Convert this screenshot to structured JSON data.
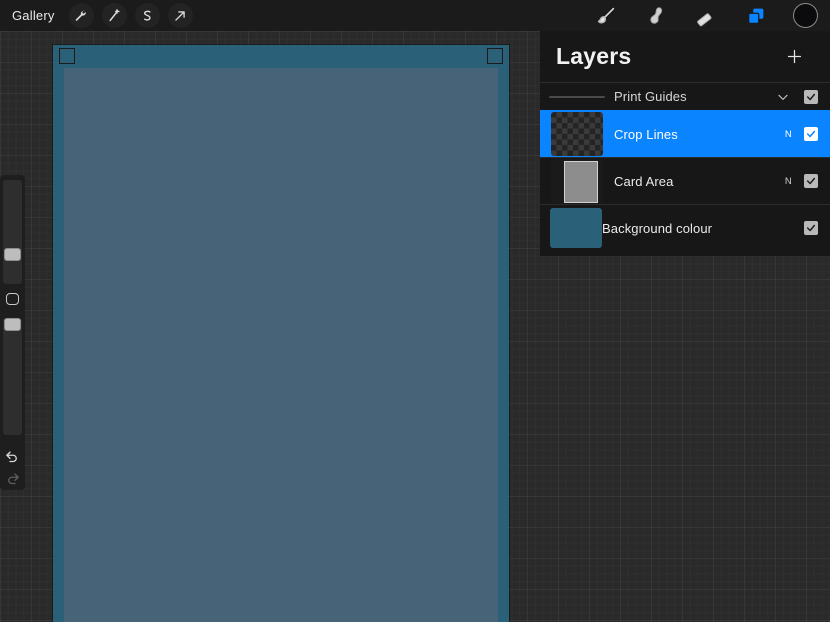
{
  "app": {
    "accent_color": "#0a84ff",
    "background_color": "#2a2a2a",
    "toolbar_color": "#1b1b1b"
  },
  "toolbar": {
    "gallery_label": "Gallery",
    "left_tools": [
      {
        "name": "actions-wrench-icon",
        "label": "Actions"
      },
      {
        "name": "adjustments-wand-icon",
        "label": "Adjustments"
      },
      {
        "name": "selection-icon",
        "label": "Selection"
      },
      {
        "name": "transform-arrow-icon",
        "label": "Transform"
      }
    ],
    "right_tools": [
      {
        "name": "paint-brush-icon",
        "label": "Paint"
      },
      {
        "name": "smudge-icon",
        "label": "Smudge"
      },
      {
        "name": "eraser-icon",
        "label": "Erase"
      },
      {
        "name": "layers-icon",
        "label": "Layers",
        "active": true
      },
      {
        "name": "color-swatch",
        "label": "Colour",
        "color": "#0b0b0d"
      }
    ]
  },
  "sidebar": {
    "brush_size": {
      "name": "brush-size-slider",
      "value_percent": 60
    },
    "modify": {
      "name": "modify-square-button",
      "label": "Modify"
    },
    "brush_opacity": {
      "name": "brush-opacity-slider",
      "value_percent": 97
    },
    "undo": {
      "name": "undo-button",
      "label": "Undo"
    },
    "redo": {
      "name": "redo-button",
      "label": "Redo"
    }
  },
  "canvas": {
    "background_colour": "#2a6179",
    "card_area_colour": "#466378",
    "crop_marks": [
      "top-left",
      "top-right"
    ]
  },
  "layers": {
    "title": "Layers",
    "add_label": "+",
    "rows": [
      {
        "name": "Print Guides",
        "type": "group",
        "blend": "",
        "visible": true,
        "selected": false,
        "thumb": "line"
      },
      {
        "name": "Crop Lines",
        "type": "layer",
        "blend": "N",
        "visible": true,
        "selected": true,
        "thumb": "checker"
      },
      {
        "name": "Card Area",
        "type": "layer",
        "blend": "N",
        "visible": true,
        "selected": false,
        "thumb": "card"
      },
      {
        "name": "Background colour",
        "type": "background",
        "blend": "",
        "visible": true,
        "selected": false,
        "thumb": "colour",
        "thumb_color": "#2a6179"
      }
    ]
  }
}
